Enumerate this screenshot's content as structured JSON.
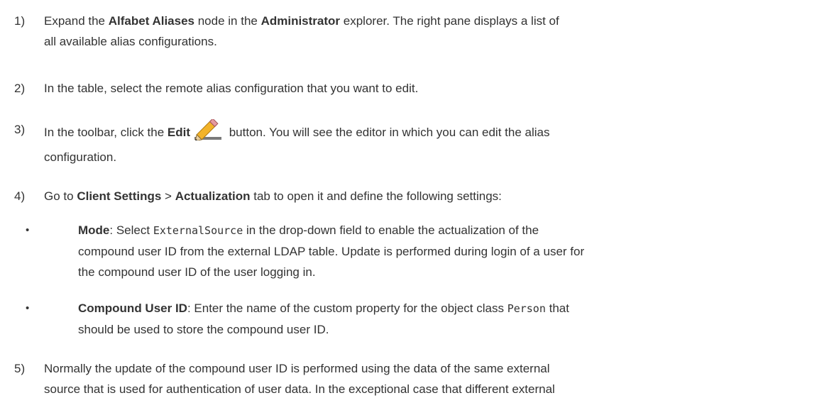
{
  "steps": [
    {
      "number": "1)",
      "t1": "Expand the ",
      "b1": "Alfabet Aliases",
      "t2": " node in the ",
      "b2": "Administrator",
      "t3": " explorer. The right pane displays a list of",
      "line2": "all available alias configurations."
    },
    {
      "number": "2)",
      "text": "In the table, select the remote alias configuration that you want to edit."
    },
    {
      "number": "3)",
      "t1": "In the toolbar, click the ",
      "b1": "Edit",
      "t2": " button. You will see the editor in which you can edit the alias",
      "line2": "configuration.",
      "icon": "pencil-icon"
    },
    {
      "number": "4)",
      "t1": "Go to ",
      "b1": "Client Settings",
      "t2": " > ",
      "b2": "Actualization",
      "t3": " tab to open it and define the following settings:"
    },
    {
      "number": "5)",
      "line1": "Normally the update of the compound user ID is performed using the data of the same external",
      "line2": "source that is used for authentication of user data. In the exceptional case that different external"
    }
  ],
  "bullets": [
    {
      "symbol": "•",
      "b1": "Mode",
      "t1": ": Select ",
      "code": "ExternalSource",
      "t2": " in the drop-down field to enable the actualization of the",
      "line2": "compound user ID from the external LDAP table. Update is performed during login of a user for",
      "line3": "the compound user ID of the user logging in."
    },
    {
      "symbol": "•",
      "b1": "Compound User ID",
      "t1": ": Enter the name of the custom property for the object class ",
      "code": "Person",
      "t2": " that",
      "line2": "should be used to store the compound user ID."
    }
  ]
}
